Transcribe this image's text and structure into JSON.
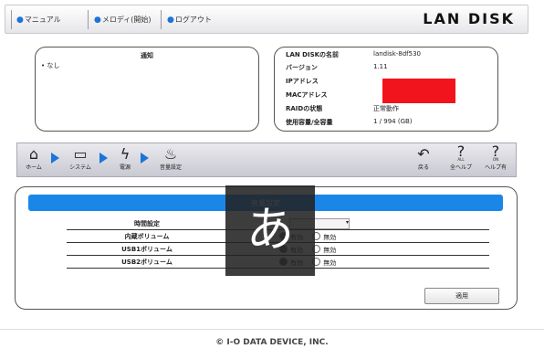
{
  "topnav": {
    "links": [
      "マニュアル",
      "メロディ(開始)",
      "ログアウト"
    ],
    "brand": "LAN DISK"
  },
  "notice": {
    "title": "通知",
    "items": [
      "なし"
    ]
  },
  "info": {
    "rows": [
      {
        "key": "LAN DISKの名前",
        "value": "landisk-8df530"
      },
      {
        "key": "バージョン",
        "value": "1.11"
      },
      {
        "key": "IPアドレス",
        "value": ""
      },
      {
        "key": "MACアドレス",
        "value": ""
      },
      {
        "key": "RAIDの状態",
        "value": "正常動作"
      },
      {
        "key": "使用容量/全容量",
        "value": "1 / 994 (GB)"
      }
    ]
  },
  "nav": {
    "home": "ホーム",
    "system": "システム",
    "power": "電源",
    "sound": "音量設定",
    "back": "戻る",
    "all_help": "全ヘルプ",
    "help_on": "ヘルプ有",
    "all_badge": "ALL",
    "on_badge": "ON"
  },
  "panel": {
    "title": "音量設定",
    "rows": [
      {
        "label": "時間設定",
        "type": "select"
      },
      {
        "label": "内蔵ボリューム",
        "options": [
          "有効",
          "無効"
        ]
      },
      {
        "label": "USB1ボリューム",
        "options": [
          "有効",
          "無効"
        ]
      },
      {
        "label": "USB2ボリューム",
        "options": [
          "有効",
          "無効"
        ]
      }
    ],
    "apply": "適用"
  },
  "ime": {
    "char": "あ"
  },
  "footer": {
    "copyright": "© I-O DATA DEVICE, INC."
  }
}
